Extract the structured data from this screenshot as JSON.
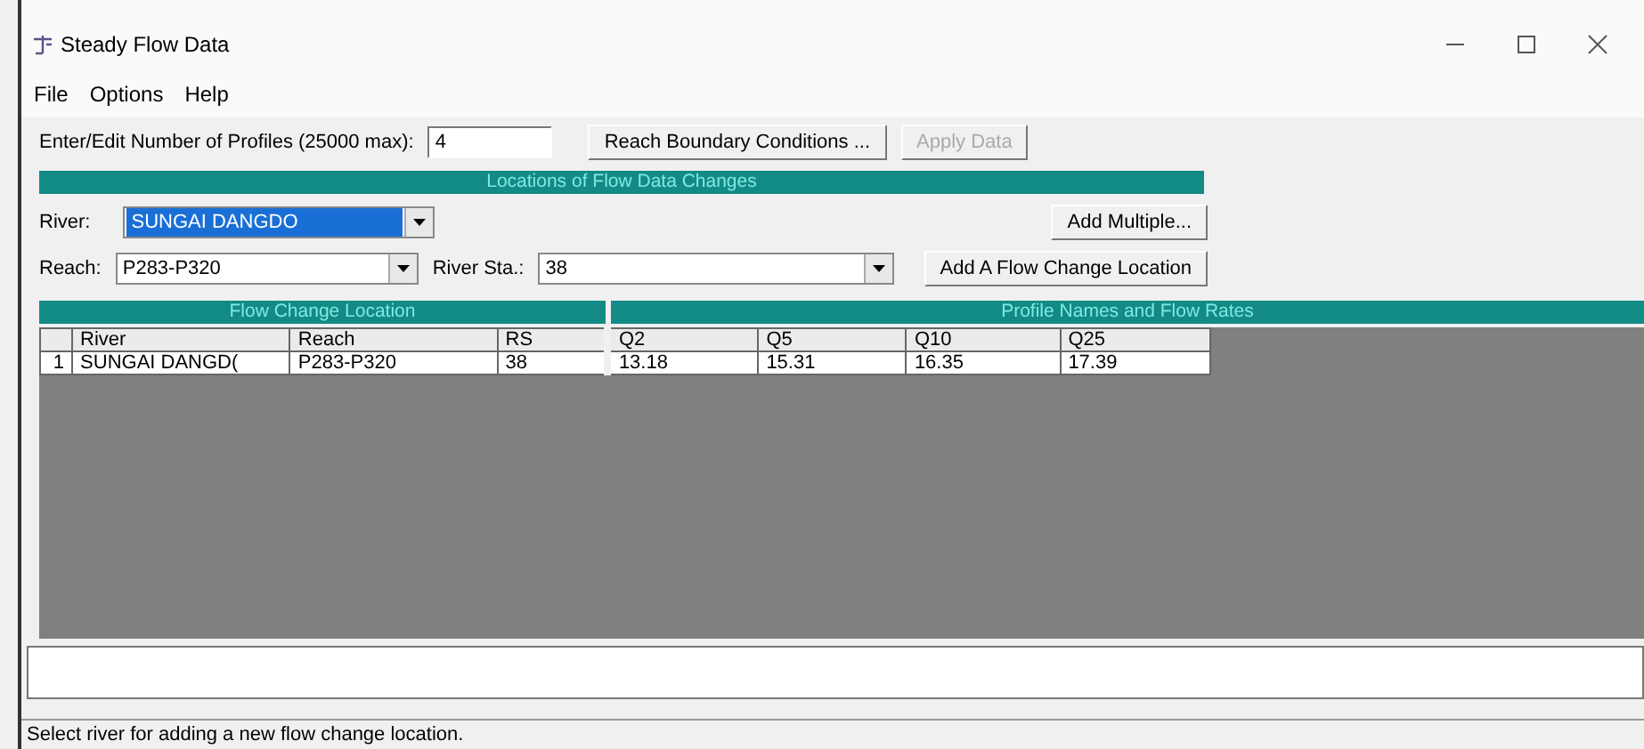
{
  "window": {
    "title": "Steady Flow Data"
  },
  "menu": [
    {
      "label": "File"
    },
    {
      "label": "Options"
    },
    {
      "label": "Help"
    }
  ],
  "profiles": {
    "label": "Enter/Edit Number of Profiles (25000 max):",
    "value": "4"
  },
  "top_buttons": [
    {
      "label": "Reach Boundary Conditions ...",
      "disabled": false
    },
    {
      "label": "Apply Data",
      "disabled": true
    }
  ],
  "section_title": "Locations of Flow Data Changes",
  "river": {
    "label": "River:",
    "value": "SUNGAI DANGDO",
    "selected": true
  },
  "add_multiple": "Add Multiple...",
  "reach": {
    "label": "Reach:",
    "value": "P283-P320"
  },
  "river_sta": {
    "label": "River Sta.:",
    "value": "38"
  },
  "add_location": "Add A Flow Change Location",
  "grid": {
    "left_group": "Flow Change Location",
    "right_group": "Profile Names and Flow Rates",
    "columns": [
      "River",
      "Reach",
      "RS",
      "Q2",
      "Q5",
      "Q10",
      "Q25"
    ],
    "rows": [
      {
        "number": "1",
        "cells": [
          "SUNGAI DANGD(",
          "P283-P320",
          "38",
          "13.18",
          "15.31",
          "16.35",
          "17.39"
        ]
      }
    ]
  },
  "status_bar": "Select river for adding a new flow change location."
}
